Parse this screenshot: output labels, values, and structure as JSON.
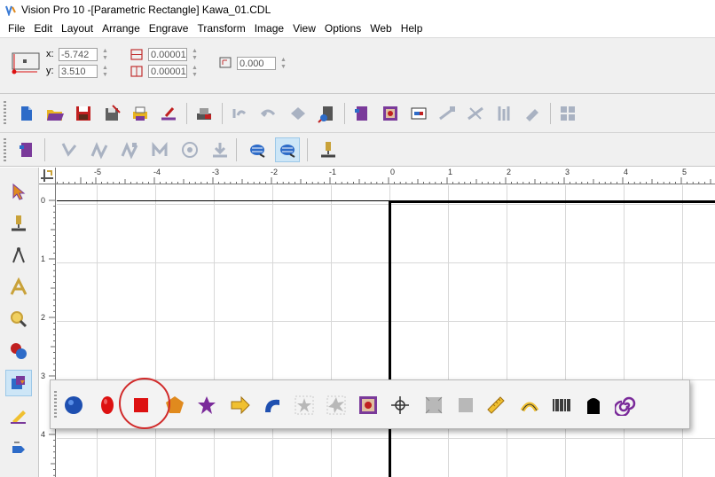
{
  "window": {
    "title": "Vision Pro 10 -[Parametric Rectangle] Kawa_01.CDL"
  },
  "menu": {
    "items": [
      "File",
      "Edit",
      "Layout",
      "Arrange",
      "Engrave",
      "Transform",
      "Image",
      "View",
      "Options",
      "Web",
      "Help"
    ]
  },
  "properties": {
    "x_label": "x:",
    "x_value": "-5.742",
    "y_label": "y:",
    "y_value": "3.510",
    "width_value": "0.00001",
    "height_value": "0.00001",
    "corner_value": "0.000"
  },
  "ruler": {
    "horizontal_labels": [
      "-5",
      "-4",
      "-3",
      "-2",
      "-1",
      "0",
      "1",
      "2",
      "3",
      "4",
      "5"
    ],
    "vertical_labels": [
      "0",
      "1",
      "2",
      "3",
      "4"
    ]
  },
  "colors": {
    "accent": "#1e73c8",
    "highlight_circle": "#d12b2b",
    "canvas_grid": "#d8d8d8"
  },
  "toolbar1_icons": [
    "new-file-icon",
    "open-file-icon",
    "save-icon",
    "save-as-icon",
    "print-icon",
    "engrave-icon",
    "stamp-icon",
    "undo-icon",
    "redo-icon",
    "zoom-icon",
    "machine-icon",
    "job-icon",
    "image-icon",
    "text-icon",
    "node-icon",
    "node-edit-icon",
    "weld-icon",
    "fill-icon",
    "group-icon"
  ],
  "toolbar2_icons": [
    "job-setup-icon",
    "path-icon",
    "path-edit-icon",
    "path-join-icon",
    "path-split-icon",
    "target-icon",
    "download-icon",
    "layer-down-icon",
    "layer-up-icon",
    "engrave-tool-icon"
  ],
  "left_tools": [
    "pointer-icon",
    "engrave-tool-icon",
    "compass-icon",
    "text-tool-icon",
    "zoom-tool-icon",
    "shapes-icon",
    "parametric-icon",
    "pencil-icon",
    "drop-icon"
  ],
  "flyout_icons": [
    "circle-icon",
    "ellipse-icon",
    "rectangle-icon",
    "pentagon-icon",
    "star-icon",
    "arrow-icon",
    "arc-icon",
    "star-outline-icon",
    "starburst-icon",
    "image-frame-icon",
    "crosshair-icon",
    "shape-frame-icon",
    "shape-square-icon",
    "ruler-icon",
    "arch-text-icon",
    "barcode-icon",
    "tombstone-icon",
    "spiral-icon"
  ]
}
